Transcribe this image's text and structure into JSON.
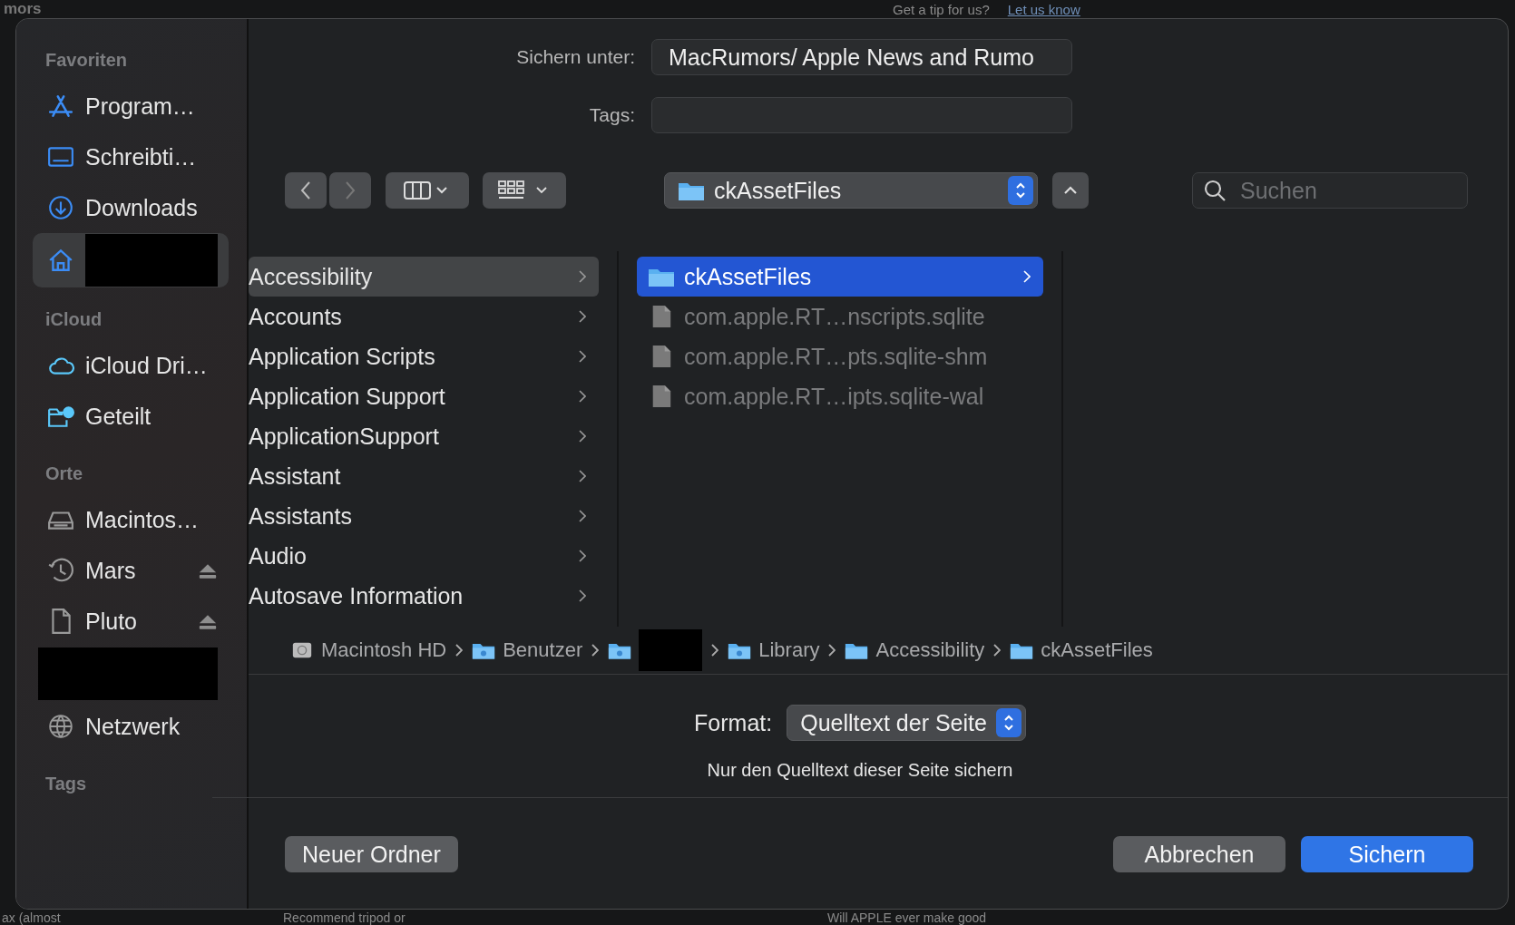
{
  "background": {
    "logo": "mors",
    "tip": "Get a tip for us?",
    "tip_link": "Let us know",
    "headlines": [
      "ax (almost",
      "Recommend tripod or",
      "Will APPLE ever make good"
    ]
  },
  "sidebar": {
    "sections": [
      {
        "title": "Favoriten",
        "items": [
          {
            "kind": "apps",
            "label": "Program…",
            "selected": false
          },
          {
            "kind": "desktop",
            "label": "Schreibti…",
            "selected": false
          },
          {
            "kind": "download",
            "label": "Downloads",
            "selected": false
          },
          {
            "kind": "home",
            "redacted": true,
            "selected": true
          }
        ]
      },
      {
        "title": "iCloud",
        "items": [
          {
            "kind": "cloud",
            "label": "iCloud Dri…",
            "selected": false
          },
          {
            "kind": "shared",
            "label": "Geteilt",
            "selected": false
          }
        ]
      },
      {
        "title": "Orte",
        "items": [
          {
            "kind": "disk",
            "label": "Macintos…",
            "selected": false
          },
          {
            "kind": "clock",
            "label": "Mars",
            "eject": true,
            "selected": false
          },
          {
            "kind": "doc",
            "label": "Pluto",
            "eject": true,
            "selected": false
          },
          {
            "kind": "blank",
            "redacted": true,
            "selected": false
          },
          {
            "kind": "globe",
            "label": "Netzwerk",
            "selected": false
          }
        ]
      },
      {
        "title": "Tags"
      }
    ]
  },
  "save_as": {
    "label": "Sichern unter:",
    "value": "MacRumors/ Apple News and Rumo"
  },
  "tags": {
    "label": "Tags:"
  },
  "location": "ckAssetFiles",
  "search": {
    "placeholder": "Suchen"
  },
  "columns": [
    {
      "active": false,
      "items": [
        {
          "name": "Accessibility",
          "kind": "folder",
          "selected": true
        },
        {
          "name": "Accounts",
          "kind": "folder",
          "selected": false
        },
        {
          "name": "Application Scripts",
          "kind": "folder",
          "selected": false
        },
        {
          "name": "Application Support",
          "kind": "folder",
          "selected": false
        },
        {
          "name": "ApplicationSupport",
          "kind": "folder",
          "selected": false
        },
        {
          "name": "Assistant",
          "kind": "folder",
          "selected": false
        },
        {
          "name": "Assistants",
          "kind": "folder",
          "selected": false
        },
        {
          "name": "Audio",
          "kind": "folder",
          "selected": false
        },
        {
          "name": "Autosave Information",
          "kind": "folder",
          "selected": false
        }
      ]
    },
    {
      "active": true,
      "items": [
        {
          "name": "ckAssetFiles",
          "kind": "folder",
          "selected": true
        },
        {
          "name": "com.apple.RT…nscripts.sqlite",
          "kind": "file",
          "selected": false
        },
        {
          "name": "com.apple.RT…pts.sqlite-shm",
          "kind": "file",
          "selected": false
        },
        {
          "name": "com.apple.RT…ipts.sqlite-wal",
          "kind": "file",
          "selected": false
        }
      ]
    }
  ],
  "path": [
    {
      "kind": "disk",
      "label": "Macintosh HD"
    },
    {
      "kind": "users",
      "label": "Benutzer"
    },
    {
      "kind": "home",
      "redacted": true
    },
    {
      "kind": "library",
      "label": "Library"
    },
    {
      "kind": "folder",
      "label": "Accessibility"
    },
    {
      "kind": "folder",
      "label": "ckAssetFiles"
    }
  ],
  "format": {
    "label": "Format:",
    "value": "Quelltext der Seite",
    "hint": "Nur den Quelltext dieser Seite sichern"
  },
  "buttons": {
    "new_folder": "Neuer Ordner",
    "cancel": "Abbrechen",
    "save": "Sichern"
  }
}
